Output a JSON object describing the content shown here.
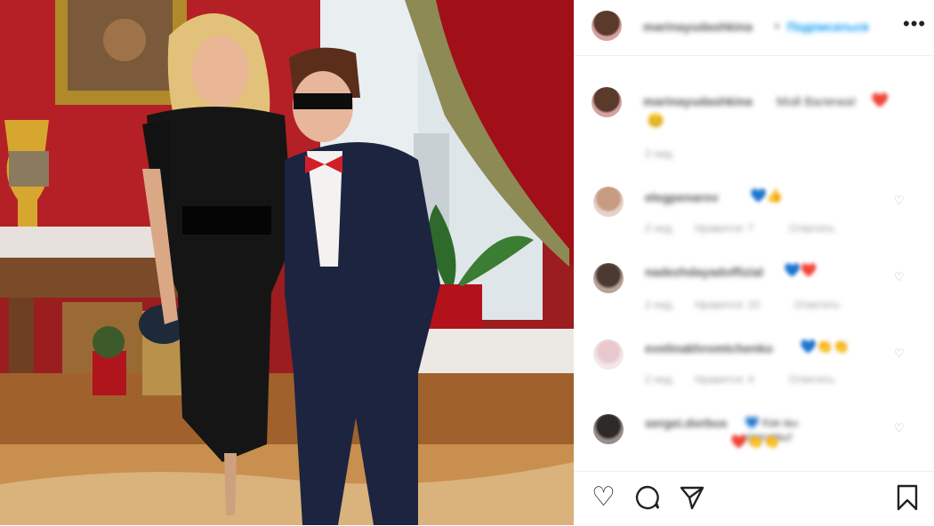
{
  "header": {
    "username": "marinayudashkina",
    "separator": "•",
    "follow_label": "Подписаться",
    "more_icon": "ellipsis-icon"
  },
  "caption": {
    "username": "marinayudashkina",
    "text": "Мой Валечка!",
    "emoji": "❤️",
    "emoji2": "😊",
    "time": "2 нед."
  },
  "comments": [
    {
      "username": "elegpenarov",
      "text": "💙👍",
      "time": "2 нед.",
      "likes": "Нравится: 7",
      "reply": "Ответить"
    },
    {
      "username": "nadezhdayadoffizial",
      "text": "💙❤️",
      "time": "2 нед.",
      "likes": "Нравится: 10",
      "reply": "Ответить"
    },
    {
      "username": "evelinakhromtchenko",
      "text": "💙👏👏",
      "time": "2 нед.",
      "likes": "Нравится: 4",
      "reply": "Ответить"
    },
    {
      "username": "sergei.dorbus",
      "text": "💙 Как вы красивы!",
      "line2": "❤️👏👏",
      "time": "",
      "likes": "",
      "reply": ""
    }
  ],
  "actions": {
    "like_icon": "heart-icon",
    "comment_icon": "comment-icon",
    "share_icon": "share-icon",
    "save_icon": "bookmark-icon"
  },
  "colors": {
    "follow": "#0095f6",
    "heart": "#e0245e"
  }
}
